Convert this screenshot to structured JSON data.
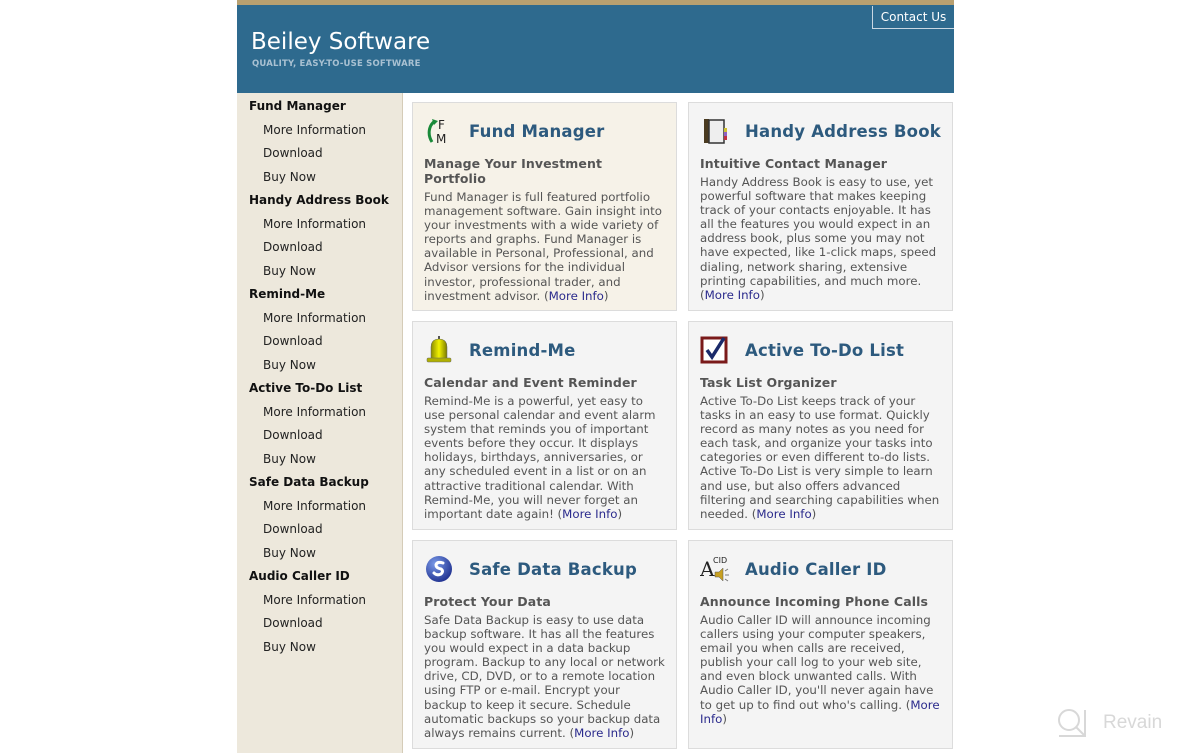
{
  "header": {
    "title": "Beiley Software",
    "tagline": "QUALITY, EASY-TO-USE SOFTWARE",
    "contact_label": "Contact Us"
  },
  "colors": {
    "header_bg": "#2e6a8e",
    "top_band": "#b8a070",
    "sidebar_bg": "#ede8dc",
    "title_blue": "#2d5a7e",
    "link_blue": "#2a2a8c"
  },
  "sidebar": {
    "groups": [
      {
        "title": "Fund Manager",
        "links": [
          "More Information",
          "Download",
          "Buy Now"
        ]
      },
      {
        "title": "Handy Address Book",
        "links": [
          "More Information",
          "Download",
          "Buy Now"
        ]
      },
      {
        "title": "Remind-Me",
        "links": [
          "More Information",
          "Download",
          "Buy Now"
        ]
      },
      {
        "title": "Active To-Do List",
        "links": [
          "More Information",
          "Download",
          "Buy Now"
        ]
      },
      {
        "title": "Safe Data Backup",
        "links": [
          "More Information",
          "Download",
          "Buy Now"
        ]
      },
      {
        "title": "Audio Caller ID",
        "links": [
          "More Information",
          "Download",
          "Buy Now"
        ]
      }
    ]
  },
  "products": [
    {
      "name": "Fund Manager",
      "icon": "fund-manager-icon",
      "subtitle": "Manage Your Investment Portfolio",
      "description": "Fund Manager is full featured portfolio management software.  Gain insight into your investments with a wide variety of reports and graphs.  Fund Manager is available in Personal, Professional, and Advisor versions for the individual investor, professional trader, and investment advisor.  (",
      "more": "More Info",
      "close": ")"
    },
    {
      "name": "Handy Address Book",
      "icon": "address-book-icon",
      "subtitle": "Intuitive Contact Manager",
      "description": "Handy Address Book is easy to use, yet powerful software that makes keeping track of your contacts enjoyable.  It has all the features you would expect in an address book, plus some you may not have expected, like 1-click maps, speed dialing, network sharing, extensive printing capabilities, and much more. (",
      "more": "More Info",
      "close": ")"
    },
    {
      "name": "Remind-Me",
      "icon": "bell-icon",
      "subtitle": "Calendar and Event Reminder",
      "description": "Remind-Me is a powerful, yet easy to use personal calendar and event alarm system that reminds you of important events before they occur.  It displays holidays, birthdays, anniversaries, or any scheduled event in a list or on an attractive traditional calendar.  With Remind-Me, you will never forget an important date again!  (",
      "more": "More Info",
      "close": ")"
    },
    {
      "name": "Active To-Do List",
      "icon": "checkbox-icon",
      "subtitle": "Task List Organizer",
      "description": "Active To-Do List keeps track of your tasks in an easy to use format.  Quickly record as many notes as you need for each task, and organize your tasks into categories or even different to-do lists. Active To-Do List is very simple to learn and use, but also offers advanced filtering and searching capabilities when needed. (",
      "more": "More Info",
      "close": ")"
    },
    {
      "name": "Safe Data Backup",
      "icon": "backup-icon",
      "subtitle": "Protect Your Data",
      "description": "Safe Data Backup is easy to use data backup software.  It has all the features you would expect in a data backup program.  Backup to any local or network drive, CD, DVD, or to a remote location using FTP or e-mail.  Encrypt your backup to keep it secure.  Schedule automatic backups so your backup data always remains current.  (",
      "more": "More Info",
      "close": ")"
    },
    {
      "name": "Audio Caller ID",
      "icon": "audio-caller-id-icon",
      "subtitle": "Announce Incoming Phone Calls",
      "description": "Audio Caller ID will announce incoming callers using your computer speakers, email you when calls are received, publish your call log to your web site, and even block unwanted calls.  With Audio Caller ID, you'll never again have to get up to find out who's calling.  (",
      "more": "More Info",
      "close": ")"
    }
  ],
  "watermark": {
    "text": "Revain"
  }
}
